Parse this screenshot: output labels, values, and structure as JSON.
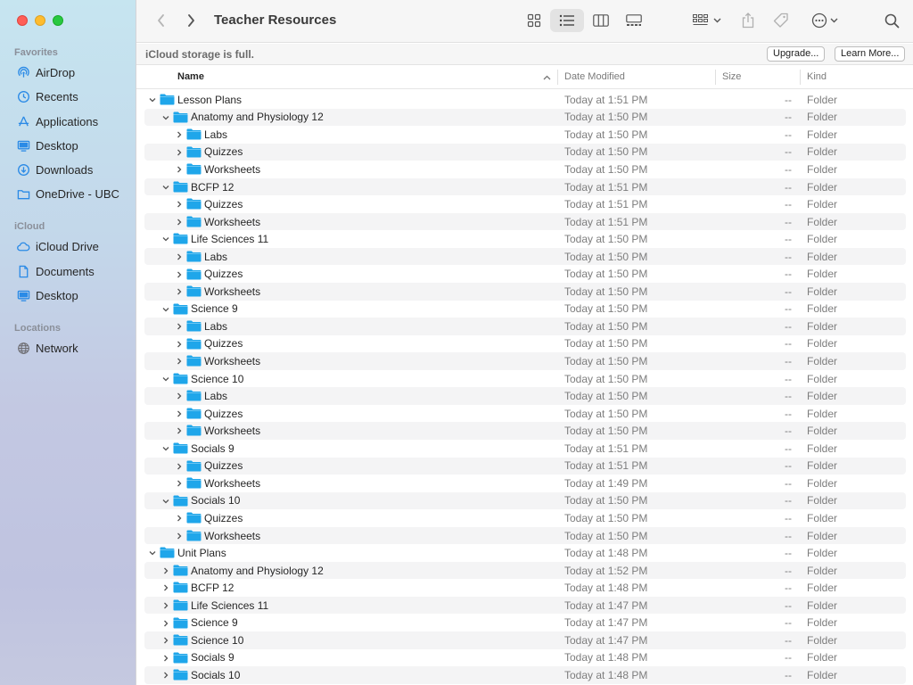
{
  "window": {
    "title": "Teacher Resources"
  },
  "sidebar": {
    "sections": [
      {
        "title": "Favorites",
        "items": [
          {
            "label": "AirDrop",
            "icon": "airdrop-icon"
          },
          {
            "label": "Recents",
            "icon": "clock-icon"
          },
          {
            "label": "Applications",
            "icon": "applications-icon"
          },
          {
            "label": "Desktop",
            "icon": "desktop-icon"
          },
          {
            "label": "Downloads",
            "icon": "download-icon"
          },
          {
            "label": "OneDrive - UBC",
            "icon": "folder-icon"
          }
        ]
      },
      {
        "title": "iCloud",
        "items": [
          {
            "label": "iCloud Drive",
            "icon": "cloud-icon"
          },
          {
            "label": "Documents",
            "icon": "document-icon"
          },
          {
            "label": "Desktop",
            "icon": "desktop-icon"
          }
        ]
      },
      {
        "title": "Locations",
        "items": [
          {
            "label": "Network",
            "icon": "globe-icon"
          }
        ]
      }
    ]
  },
  "banner": {
    "text": "iCloud storage is full.",
    "upgrade_label": "Upgrade...",
    "learn_more_label": "Learn More..."
  },
  "columns": {
    "name": "Name",
    "date": "Date Modified",
    "size": "Size",
    "kind": "Kind"
  },
  "colors": {
    "folder": "#1fa6ea",
    "accent": "#0a84ff",
    "alt_row": "#f4f4f5"
  },
  "rows": [
    {
      "name": "Lesson Plans",
      "level": 0,
      "expanded": true,
      "date": "Today at 1:51 PM",
      "size": "--",
      "kind": "Folder"
    },
    {
      "name": "Anatomy and Physiology 12",
      "level": 1,
      "expanded": true,
      "date": "Today at 1:50 PM",
      "size": "--",
      "kind": "Folder"
    },
    {
      "name": "Labs",
      "level": 2,
      "expanded": false,
      "date": "Today at 1:50 PM",
      "size": "--",
      "kind": "Folder"
    },
    {
      "name": "Quizzes",
      "level": 2,
      "expanded": false,
      "date": "Today at 1:50 PM",
      "size": "--",
      "kind": "Folder"
    },
    {
      "name": "Worksheets",
      "level": 2,
      "expanded": false,
      "date": "Today at 1:50 PM",
      "size": "--",
      "kind": "Folder"
    },
    {
      "name": "BCFP 12",
      "level": 1,
      "expanded": true,
      "date": "Today at 1:51 PM",
      "size": "--",
      "kind": "Folder"
    },
    {
      "name": "Quizzes",
      "level": 2,
      "expanded": false,
      "date": "Today at 1:51 PM",
      "size": "--",
      "kind": "Folder"
    },
    {
      "name": "Worksheets",
      "level": 2,
      "expanded": false,
      "date": "Today at 1:51 PM",
      "size": "--",
      "kind": "Folder"
    },
    {
      "name": "Life Sciences 11",
      "level": 1,
      "expanded": true,
      "date": "Today at 1:50 PM",
      "size": "--",
      "kind": "Folder"
    },
    {
      "name": "Labs",
      "level": 2,
      "expanded": false,
      "date": "Today at 1:50 PM",
      "size": "--",
      "kind": "Folder"
    },
    {
      "name": "Quizzes",
      "level": 2,
      "expanded": false,
      "date": "Today at 1:50 PM",
      "size": "--",
      "kind": "Folder"
    },
    {
      "name": "Worksheets",
      "level": 2,
      "expanded": false,
      "date": "Today at 1:50 PM",
      "size": "--",
      "kind": "Folder"
    },
    {
      "name": "Science 9",
      "level": 1,
      "expanded": true,
      "date": "Today at 1:50 PM",
      "size": "--",
      "kind": "Folder"
    },
    {
      "name": "Labs",
      "level": 2,
      "expanded": false,
      "date": "Today at 1:50 PM",
      "size": "--",
      "kind": "Folder"
    },
    {
      "name": "Quizzes",
      "level": 2,
      "expanded": false,
      "date": "Today at 1:50 PM",
      "size": "--",
      "kind": "Folder"
    },
    {
      "name": "Worksheets",
      "level": 2,
      "expanded": false,
      "date": "Today at 1:50 PM",
      "size": "--",
      "kind": "Folder"
    },
    {
      "name": "Science 10",
      "level": 1,
      "expanded": true,
      "date": "Today at 1:50 PM",
      "size": "--",
      "kind": "Folder"
    },
    {
      "name": "Labs",
      "level": 2,
      "expanded": false,
      "date": "Today at 1:50 PM",
      "size": "--",
      "kind": "Folder"
    },
    {
      "name": "Quizzes",
      "level": 2,
      "expanded": false,
      "date": "Today at 1:50 PM",
      "size": "--",
      "kind": "Folder"
    },
    {
      "name": "Worksheets",
      "level": 2,
      "expanded": false,
      "date": "Today at 1:50 PM",
      "size": "--",
      "kind": "Folder"
    },
    {
      "name": "Socials 9",
      "level": 1,
      "expanded": true,
      "date": "Today at 1:51 PM",
      "size": "--",
      "kind": "Folder"
    },
    {
      "name": "Quizzes",
      "level": 2,
      "expanded": false,
      "date": "Today at 1:51 PM",
      "size": "--",
      "kind": "Folder"
    },
    {
      "name": "Worksheets",
      "level": 2,
      "expanded": false,
      "date": "Today at 1:49 PM",
      "size": "--",
      "kind": "Folder"
    },
    {
      "name": "Socials 10",
      "level": 1,
      "expanded": true,
      "date": "Today at 1:50 PM",
      "size": "--",
      "kind": "Folder"
    },
    {
      "name": "Quizzes",
      "level": 2,
      "expanded": false,
      "date": "Today at 1:50 PM",
      "size": "--",
      "kind": "Folder"
    },
    {
      "name": "Worksheets",
      "level": 2,
      "expanded": false,
      "date": "Today at 1:50 PM",
      "size": "--",
      "kind": "Folder"
    },
    {
      "name": "Unit Plans",
      "level": 0,
      "expanded": true,
      "date": "Today at 1:48 PM",
      "size": "--",
      "kind": "Folder"
    },
    {
      "name": "Anatomy and Physiology 12",
      "level": 1,
      "expanded": false,
      "date": "Today at 1:52 PM",
      "size": "--",
      "kind": "Folder"
    },
    {
      "name": "BCFP 12",
      "level": 1,
      "expanded": false,
      "date": "Today at 1:48 PM",
      "size": "--",
      "kind": "Folder"
    },
    {
      "name": "Life Sciences 11",
      "level": 1,
      "expanded": false,
      "date": "Today at 1:47 PM",
      "size": "--",
      "kind": "Folder"
    },
    {
      "name": "Science 9",
      "level": 1,
      "expanded": false,
      "date": "Today at 1:47 PM",
      "size": "--",
      "kind": "Folder"
    },
    {
      "name": "Science 10",
      "level": 1,
      "expanded": false,
      "date": "Today at 1:47 PM",
      "size": "--",
      "kind": "Folder"
    },
    {
      "name": "Socials 9",
      "level": 1,
      "expanded": false,
      "date": "Today at 1:48 PM",
      "size": "--",
      "kind": "Folder"
    },
    {
      "name": "Socials 10",
      "level": 1,
      "expanded": false,
      "date": "Today at 1:48 PM",
      "size": "--",
      "kind": "Folder"
    }
  ]
}
